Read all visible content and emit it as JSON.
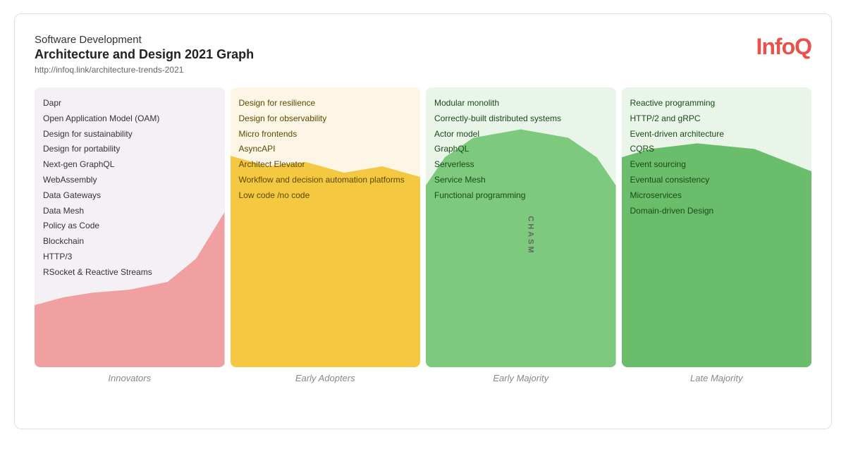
{
  "header": {
    "line1": "Software Development",
    "line2": "Architecture and Design 2021 Graph",
    "url": "http://infoq.link/architecture-trends-2021"
  },
  "logo": {
    "text1": "Info",
    "text2": "Q"
  },
  "columns": [
    {
      "id": "innovators",
      "label": "Innovators",
      "items": [
        "Dapr",
        "Open Application Model (OAM)",
        "Design for sustainability",
        "Design for portability",
        "Next-gen GraphQL",
        "WebAssembly",
        "Data Gateways",
        "Data Mesh",
        "Policy as Code",
        "Blockchain",
        "HTTP/3",
        "RSocket & Reactive Streams"
      ]
    },
    {
      "id": "early-adopters",
      "label": "Early Adopters",
      "items": [
        "Design for resilience",
        "Design for observability",
        "Micro frontends",
        "AsyncAPI",
        "Architect Elevator",
        "Workflow and decision automation platforms",
        "Low code /no code"
      ]
    },
    {
      "id": "early-majority",
      "label": "Early Majority",
      "chasm": "CHASM",
      "items": [
        "Modular monolith",
        "Correctly-built distributed systems",
        "Actor model",
        "GraphQL",
        "Serverless",
        "Service Mesh",
        "Functional programming"
      ]
    },
    {
      "id": "late-majority",
      "label": "Late Majority",
      "items": [
        "Reactive programming",
        "HTTP/2 and gRPC",
        "Event-driven architecture",
        "CQRS",
        "Event sourcing",
        "Eventual consistency",
        "Microservices",
        "Domain-driven Design"
      ]
    }
  ]
}
